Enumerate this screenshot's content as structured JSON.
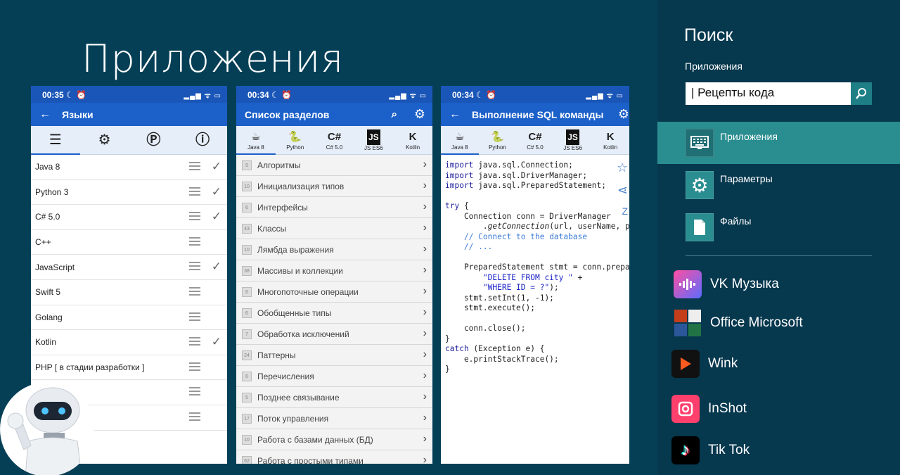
{
  "page": {
    "title": "Приложения"
  },
  "phone1": {
    "time": "00:35 ☾ ⏰",
    "title": "Языки",
    "rows": [
      {
        "label": "Java 8",
        "checked": true
      },
      {
        "label": "Python 3",
        "checked": true
      },
      {
        "label": "C# 5.0",
        "checked": true
      },
      {
        "label": "C++",
        "checked": false
      },
      {
        "label": "JavaScript",
        "checked": true
      },
      {
        "label": "Swift 5",
        "checked": false
      },
      {
        "label": "Golang",
        "checked": false
      },
      {
        "label": "Kotlin",
        "checked": true
      },
      {
        "label": "PHP [ в стадии разработки ]",
        "checked": false
      },
      {
        "label": "",
        "checked": false
      },
      {
        "label": "",
        "checked": false
      }
    ]
  },
  "phone2": {
    "time": "00:34 ☾ ⏰",
    "title": "Список разделов",
    "langs": [
      "Java 8",
      "Python",
      "C# 5.0",
      "JS ES6",
      "Kotlin"
    ],
    "rows": [
      {
        "num": "9",
        "label": "Алгоритмы"
      },
      {
        "num": "10",
        "label": "Инициализация типов"
      },
      {
        "num": "6",
        "label": "Интерфейсы"
      },
      {
        "num": "43",
        "label": "Классы"
      },
      {
        "num": "10",
        "label": "Лямбда выражения"
      },
      {
        "num": "38",
        "label": "Массивы и коллекции"
      },
      {
        "num": "6",
        "label": "Многопоточные операции"
      },
      {
        "num": "6",
        "label": "Обобщенные типы"
      },
      {
        "num": "7",
        "label": "Обработка исключений"
      },
      {
        "num": "24",
        "label": "Паттерны"
      },
      {
        "num": "6",
        "label": "Перечисления"
      },
      {
        "num": "5",
        "label": "Позднее связывание"
      },
      {
        "num": "17",
        "label": "Поток управления"
      },
      {
        "num": "10",
        "label": "Работа с базами данных (БД)"
      },
      {
        "num": "62",
        "label": "Работа с простыми типами"
      }
    ]
  },
  "phone3": {
    "time": "00:34 ☾ ⏰",
    "title": "Выполнение SQL команды"
  },
  "charm": {
    "title": "Поиск",
    "scope": "Приложения",
    "query": "| Рецепты кода",
    "categories": [
      "Приложения",
      "Параметры",
      "Файлы"
    ],
    "apps": [
      "VK Музыка",
      "Office Microsoft",
      "Wink",
      "InShot",
      "Tik Tok"
    ]
  },
  "colors": {
    "background": "#053f56",
    "panel": "#06384e",
    "accent": "#2a8d8f",
    "appbar": "#1c60c9"
  }
}
